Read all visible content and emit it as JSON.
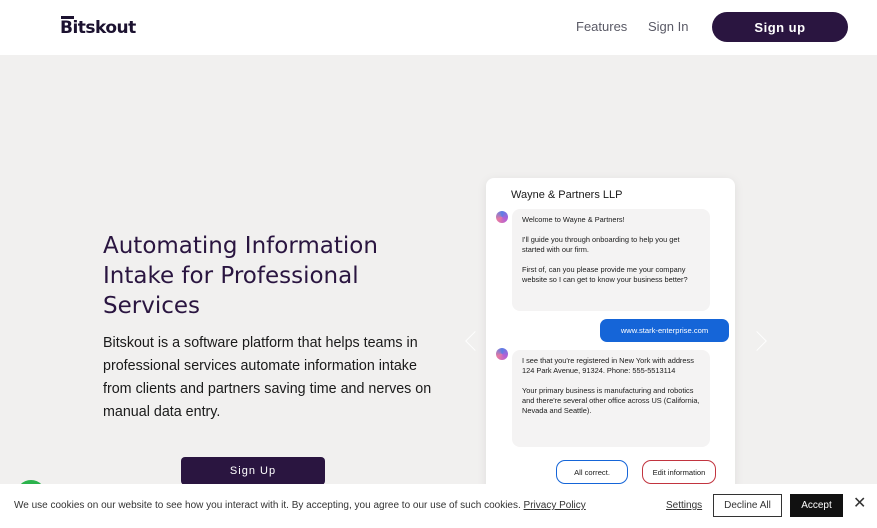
{
  "header": {
    "logo": "Bitskout",
    "nav": [
      "Features",
      "Sign In"
    ],
    "signup_label": "Sign up"
  },
  "hero": {
    "title": "Automating Information Intake for Professional Services",
    "description": "Bitskout is a software platform that helps teams in professional services automate information intake from clients and partners saving time and nerves on manual data entry.",
    "cta": "Sign Up"
  },
  "chat": {
    "title": "Wayne & Partners LLP",
    "bot_message_1": [
      "Welcome to Wayne & Partners!",
      "I'll guide you through onboarding to help you get started with our firm.",
      "First of, can you please provide me your company website so I can get to know your business better?"
    ],
    "user_message": "www.stark-enterprise.com",
    "bot_message_2": [
      "I see that you're registered in New York with address 124 Park Avenue, 91324. Phone: 555-5513114",
      "Your primary business is manufacturing and robotics and there're several other office across US (California, Nevada and Seattle)."
    ],
    "options": [
      "All correct.",
      "Edit information"
    ]
  },
  "cookie": {
    "text": "We use cookies on our website to see how you interact with it. By accepting, you agree to our use of such cookies.",
    "privacy_link": "Privacy Policy",
    "settings": "Settings",
    "decline": "Decline All",
    "accept": "Accept",
    "close": "✕"
  },
  "colors": {
    "brand": "#2a1540",
    "accent_blue": "#1565d8",
    "page_bg": "#f1f0ef"
  }
}
